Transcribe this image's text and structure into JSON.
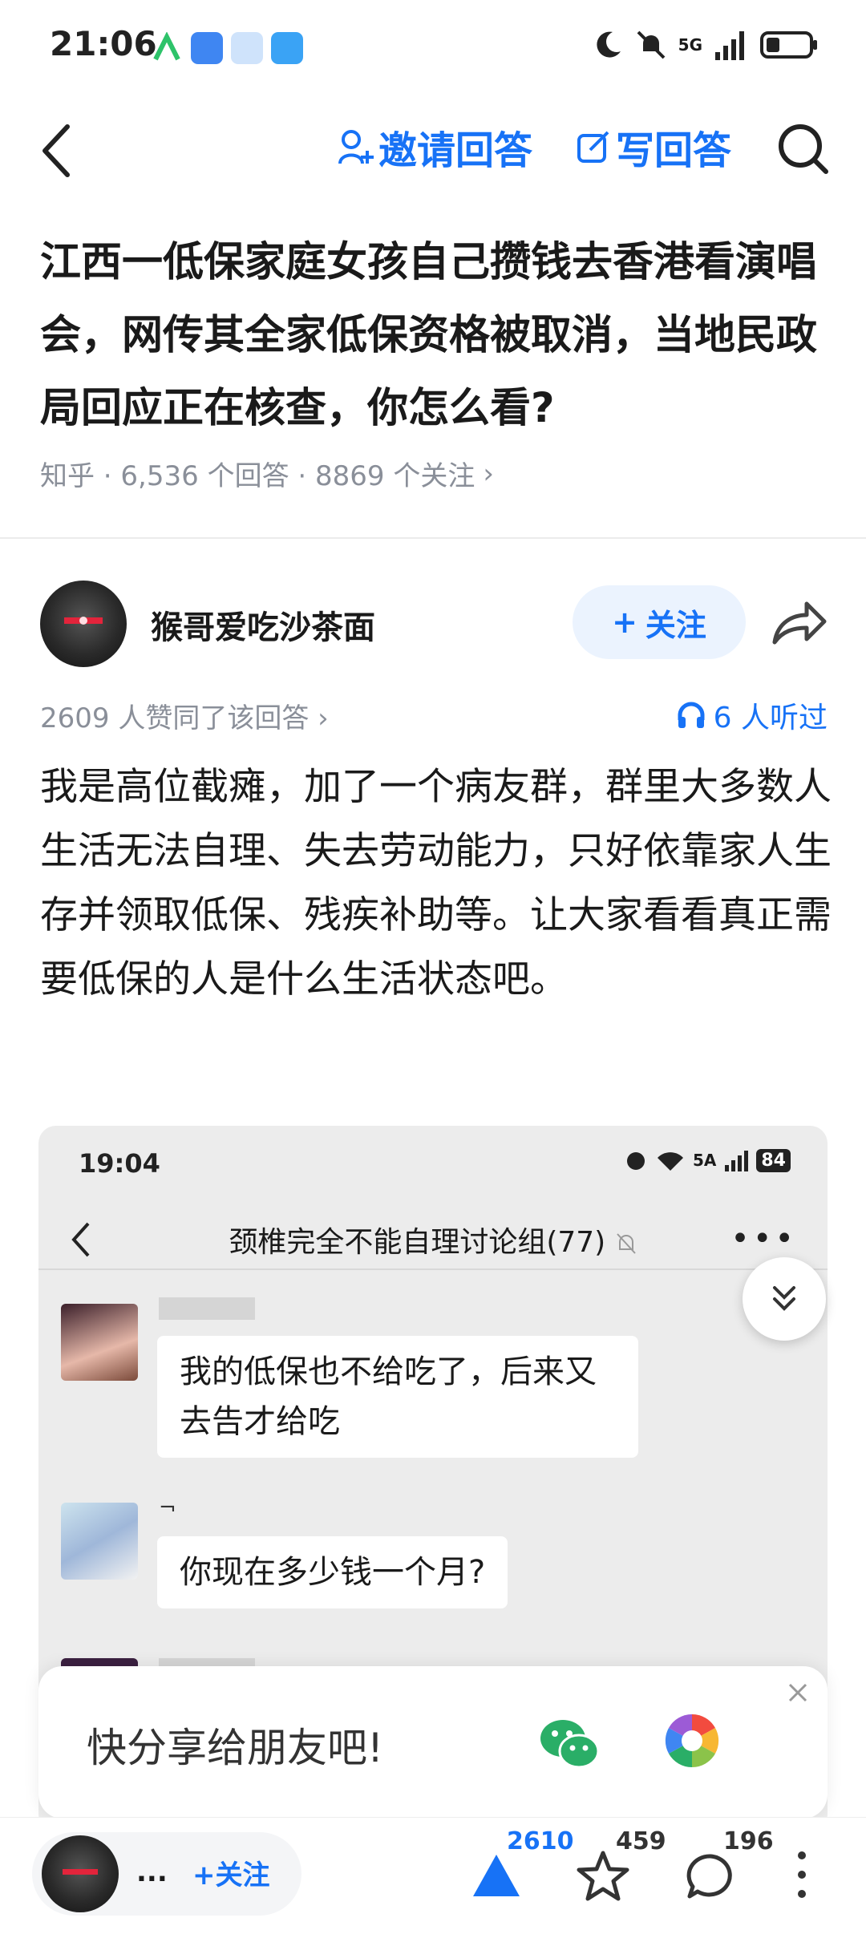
{
  "status_bar": {
    "time": "21:06",
    "network": "5G",
    "icons": [
      "moon-icon",
      "mute-bell-icon",
      "signal-icon",
      "battery-icon"
    ]
  },
  "nav": {
    "invite_answer": "邀请回答",
    "write_answer": "写回答"
  },
  "question": {
    "title": "江西一低保家庭女孩自己攒钱去香港看演唱会，网传其全家低保资格被取消，当地民政局回应正在核查，你怎么看?",
    "meta": "知乎 · 6,536 个回答 · 8869 个关注",
    "meta_arrow": "›"
  },
  "answer": {
    "author_name": "猴哥爱吃沙茶面",
    "follow_label": "关注",
    "likes_text": "2609 人赞同了该回答 ›",
    "listened_text": "6 人听过",
    "body": "我是高位截瘫，加了一个病友群，群里大多数人生活无法自理、失去劳动能力，只好依靠家人生存并领取低保、残疾补助等。让大家看看真正需要低保的人是什么生活状态吧。"
  },
  "embedded_screenshot": {
    "time": "19:04",
    "network": "5A",
    "battery": "84",
    "chat_title": "颈椎完全不能自理讨论组(77)",
    "messages": [
      {
        "text": "我的低保也不给吃了，后来又去告才给吃"
      },
      {
        "name": "¬",
        "text": "你现在多少钱一个月?"
      }
    ]
  },
  "share_popup": {
    "text": "快分享给朋友吧!"
  },
  "bottom_bar": {
    "author_short": "...",
    "follow_label": "关注",
    "upvotes": "2610",
    "favorites": "459",
    "comments": "196"
  },
  "colors": {
    "accent": "#1772f6",
    "muted": "#8a8f99",
    "wechat": "#2aae67"
  }
}
